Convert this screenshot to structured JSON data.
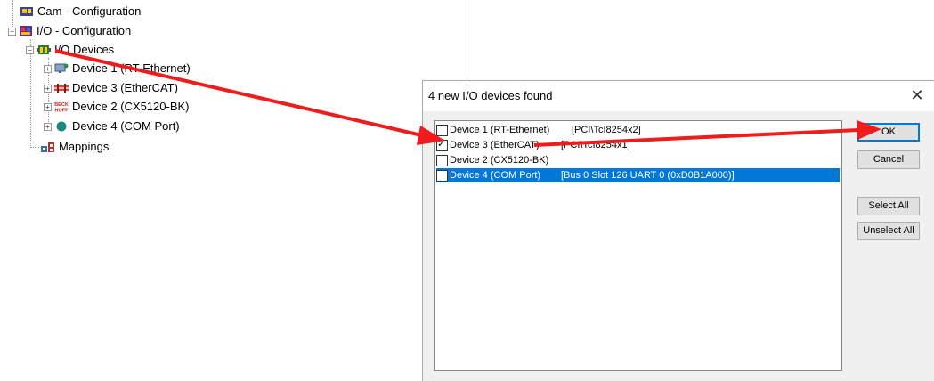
{
  "tree": {
    "items": [
      {
        "label": "Cam - Configuration",
        "icon": "cam-config-icon"
      },
      {
        "label": "I/O - Configuration",
        "icon": "io-config-icon"
      },
      {
        "label": "I/O Devices",
        "icon": "io-devices-icon"
      },
      {
        "label": "Device 1 (RT-Ethernet)",
        "icon": "ethernet-device-icon"
      },
      {
        "label": "Device 3 (EtherCAT)",
        "icon": "ethercat-device-icon"
      },
      {
        "label": "Device 2 (CX5120-BK)",
        "icon": "beckhoff-device-icon",
        "icon_text": "BECK HOFF"
      },
      {
        "label": "Device 4 (COM Port)",
        "icon": "com-port-icon"
      },
      {
        "label": "Mappings",
        "icon": "mappings-icon"
      }
    ]
  },
  "dialog": {
    "title": "4 new I/O devices found",
    "close_glyph": "✕",
    "devices": [
      {
        "name": "Device 1 (RT-Ethernet)",
        "address": "[PCI\\TcI8254x2]",
        "checked": false,
        "selected": false
      },
      {
        "name": "Device 3 (EtherCAT)",
        "address": "[PCI\\TcI8254x1]",
        "checked": true,
        "selected": false
      },
      {
        "name": "Device 2 (CX5120-BK)",
        "address": "",
        "checked": false,
        "selected": false
      },
      {
        "name": "Device 4 (COM Port)",
        "address": "[Bus 0 Slot 126 UART 0 (0xD0B1A000)]",
        "checked": false,
        "selected": true
      }
    ],
    "buttons": {
      "ok": "OK",
      "cancel": "Cancel",
      "select_all": "Select All",
      "unselect_all": "Unselect All"
    }
  },
  "colors": {
    "selection": "#0078d7",
    "annotation_arrow": "#ee1c1c"
  }
}
